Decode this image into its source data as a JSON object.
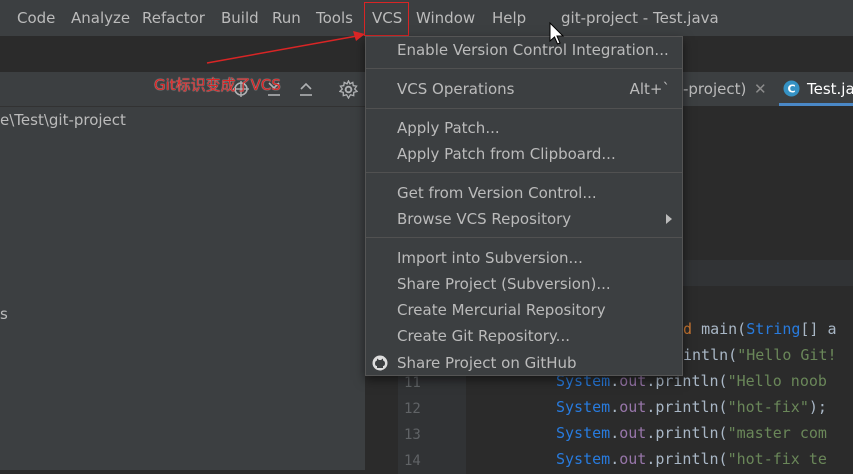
{
  "menubar": {
    "items": [
      "Code",
      "Analyze",
      "Refactor",
      "Build",
      "Run",
      "Tools",
      "VCS",
      "Window",
      "Help"
    ],
    "title": "git-project - Test.java"
  },
  "annotation": {
    "text": "Git标识变成了VCS",
    "color": "#d92525"
  },
  "project_panel": {
    "path": "e\\Test\\git-project",
    "partial_item": "s"
  },
  "editor": {
    "tab_prev_fragment": "-project)",
    "tab_active": "Test.java",
    "gutter_lines": [
      "11",
      "12",
      "13",
      "14"
    ],
    "code_lines": [
      "d main(String[] a",
      "intln(\"Hello Git!",
      "System.out.println(\"Hello noob",
      "System.out.println(\"hot-fix\");",
      "System.out.println(\"master com",
      "System.out.println(\"hot-fix te"
    ]
  },
  "vcs_menu": {
    "items": [
      {
        "label": "Enable Version Control Integration..."
      },
      {
        "label": "VCS Operations",
        "shortcut": "Alt+`"
      },
      {
        "label": "Apply Patch..."
      },
      {
        "label": "Apply Patch from Clipboard..."
      },
      {
        "label": "Get from Version Control..."
      },
      {
        "label": "Browse VCS Repository"
      },
      {
        "label": "Import into Subversion..."
      },
      {
        "label": "Share Project (Subversion)..."
      },
      {
        "label": "Create Mercurial Repository"
      },
      {
        "label": "Create Git Repository..."
      },
      {
        "label": "Share Project on GitHub",
        "icon": "github-icon"
      }
    ]
  },
  "colors": {
    "menubar_bg": "#3c3f41",
    "editor_bg": "#2b2b2b",
    "highlight_border": "#d92525",
    "string_green": "#6a8759",
    "class_blue": "#287bde",
    "field_purple": "#9876aa"
  }
}
